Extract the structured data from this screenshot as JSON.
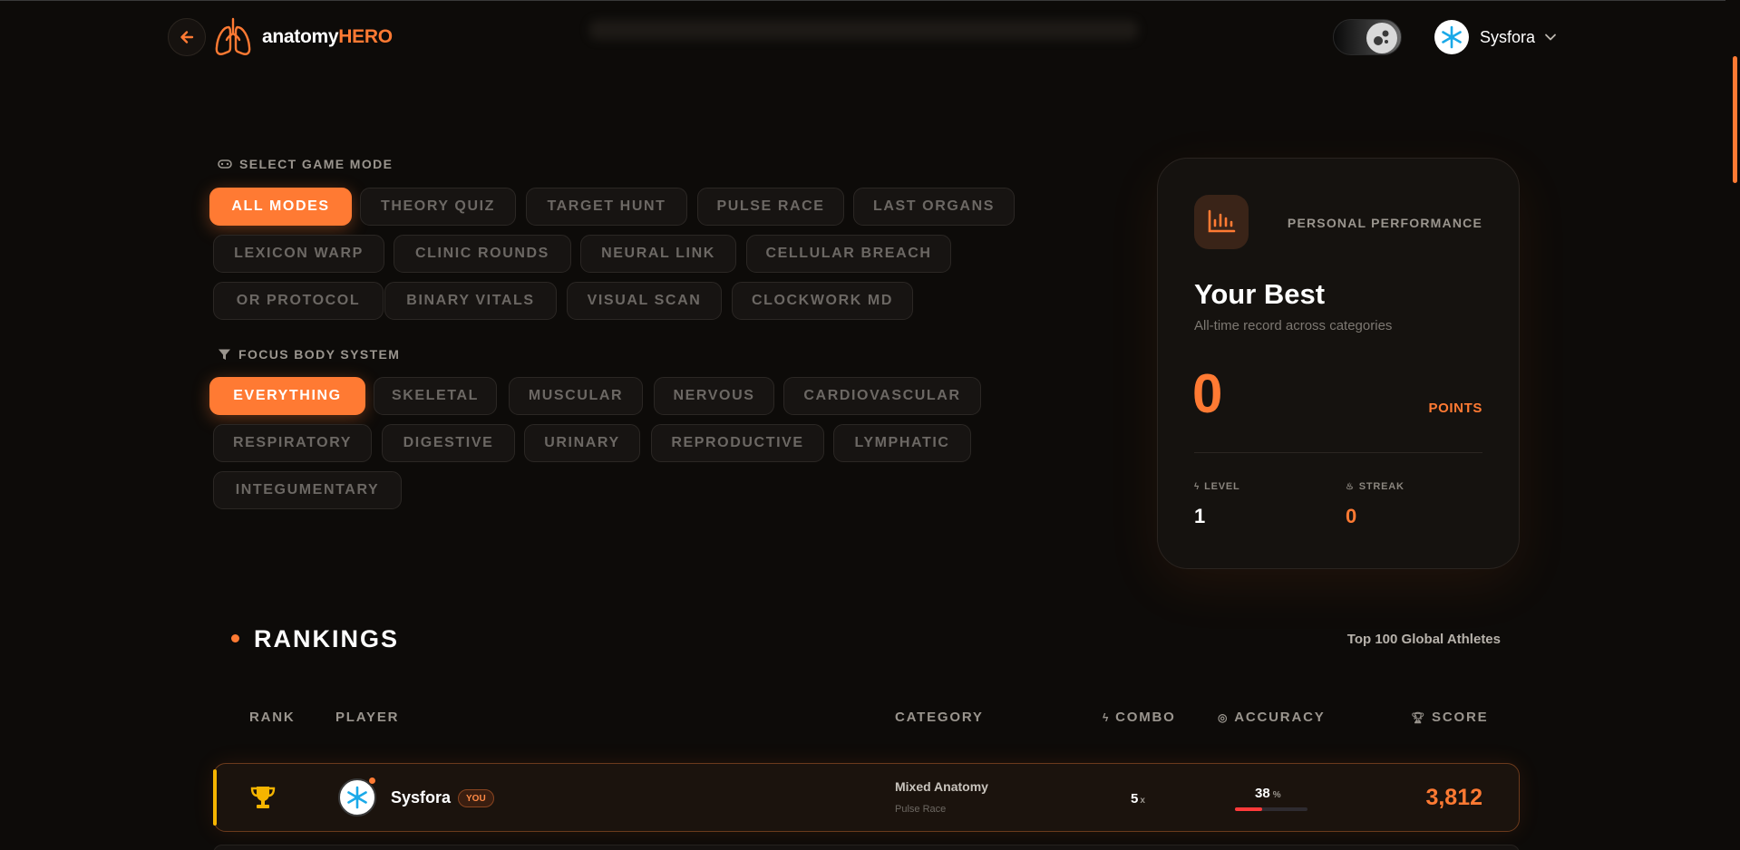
{
  "header": {
    "logo_text_white": "anatomy",
    "logo_text_orange": "HERO",
    "user_name": "Sysfora"
  },
  "game_mode": {
    "label": "SELECT GAME MODE",
    "chips": [
      "ALL MODES",
      "THEORY QUIZ",
      "TARGET HUNT",
      "PULSE RACE",
      "LAST ORGANS",
      "LEXICON WARP",
      "CLINIC ROUNDS",
      "NEURAL LINK",
      "CELLULAR BREACH",
      "OR PROTOCOL",
      "BINARY VITALS",
      "VISUAL SCAN",
      "CLOCKWORK MD"
    ],
    "active": "ALL MODES"
  },
  "body_system": {
    "label": "FOCUS BODY SYSTEM",
    "chips": [
      "EVERYTHING",
      "SKELETAL",
      "MUSCULAR",
      "NERVOUS",
      "CARDIOVASCULAR",
      "RESPIRATORY",
      "DIGESTIVE",
      "URINARY",
      "REPRODUCTIVE",
      "LYMPHATIC",
      "INTEGUMENTARY"
    ],
    "active": "EVERYTHING"
  },
  "performance": {
    "eyebrow": "PERSONAL PERFORMANCE",
    "title": "Your Best",
    "subtitle": "All-time record across categories",
    "points": "0",
    "points_label": "POINTS",
    "level_label": "LEVEL",
    "level_value": "1",
    "streak_label": "STREAK",
    "streak_value": "0"
  },
  "rankings": {
    "title": "RANKINGS",
    "subtitle": "Top 100 Global Athletes",
    "columns": {
      "rank": "RANK",
      "player": "PLAYER",
      "category": "CATEGORY",
      "combo": "COMBO",
      "accuracy": "ACCURACY",
      "score": "SCORE"
    },
    "rows": [
      {
        "player": "Sysfora",
        "badge": "YOU",
        "category": "Mixed Anatomy",
        "mode": "Pulse Race",
        "combo": "5",
        "combo_unit": "x",
        "accuracy": "38",
        "accuracy_unit": "%",
        "accuracy_fraction": 0.38,
        "score": "3,812"
      }
    ]
  },
  "colors": {
    "accent": "#ff7a33",
    "background": "#0d0b09",
    "gold": "#f5b400",
    "accuracy_bar": "#ff3a3a"
  },
  "icons": [
    "back-arrow-icon",
    "lungs-logo-icon",
    "moon-icon",
    "snowflake-avatar-icon",
    "chevron-down-icon",
    "gamepad-icon",
    "filter-icon",
    "bar-chart-icon",
    "bolt-icon",
    "flame-icon",
    "target-icon",
    "trophy-icon"
  ]
}
